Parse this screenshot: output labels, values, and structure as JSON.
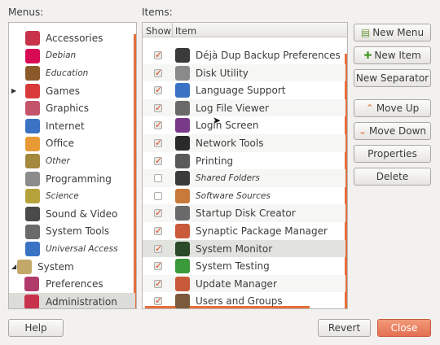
{
  "labels": {
    "menus": "Menus:",
    "items": "Items:"
  },
  "menus": [
    {
      "label": "Accessories",
      "icon": "accessories-icon",
      "italic": false,
      "color": "#c8324a",
      "kind": "top"
    },
    {
      "label": "Debian",
      "icon": "debian-icon",
      "italic": true,
      "color": "#d70a53",
      "kind": "top"
    },
    {
      "label": "Education",
      "icon": "education-icon",
      "italic": true,
      "color": "#8b5a2b",
      "kind": "top"
    },
    {
      "label": "Games",
      "icon": "games-icon",
      "italic": false,
      "color": "#d83a3a",
      "kind": "top",
      "expander": "▶"
    },
    {
      "label": "Graphics",
      "icon": "graphics-icon",
      "italic": false,
      "color": "#c4546a",
      "kind": "top"
    },
    {
      "label": "Internet",
      "icon": "internet-icon",
      "italic": false,
      "color": "#3a73c4",
      "kind": "top"
    },
    {
      "label": "Office",
      "icon": "office-icon",
      "italic": false,
      "color": "#e89a34",
      "kind": "top"
    },
    {
      "label": "Other",
      "icon": "other-icon",
      "italic": true,
      "color": "#a3883e",
      "kind": "top"
    },
    {
      "label": "Programming",
      "icon": "programming-icon",
      "italic": false,
      "color": "#8c8c8c",
      "kind": "top"
    },
    {
      "label": "Science",
      "icon": "science-icon",
      "italic": true,
      "color": "#b5a23a",
      "kind": "top"
    },
    {
      "label": "Sound & Video",
      "icon": "sound-video-icon",
      "italic": false,
      "color": "#4a4a4a",
      "kind": "top"
    },
    {
      "label": "System Tools",
      "icon": "system-tools-icon",
      "italic": false,
      "color": "#6a6a6a",
      "kind": "top"
    },
    {
      "label": "Universal Access",
      "icon": "universal-access-icon",
      "italic": true,
      "color": "#3a73c4",
      "kind": "top"
    },
    {
      "label": "System",
      "icon": "system-icon",
      "italic": false,
      "color": "#c4a86a",
      "kind": "system",
      "expander": "◢"
    },
    {
      "label": "Preferences",
      "icon": "preferences-icon",
      "italic": false,
      "color": "#b03a6a",
      "kind": "child"
    },
    {
      "label": "Administration",
      "icon": "administration-icon",
      "italic": false,
      "color": "#c8324a",
      "kind": "child",
      "selected": true
    }
  ],
  "items_header": {
    "show": "Show",
    "item": "Item"
  },
  "items": [
    {
      "label": "Déjà Dup Backup Preferences",
      "icon": "backup-icon",
      "checked": true,
      "italic": false,
      "color": "#3a3a3a"
    },
    {
      "label": "Disk Utility",
      "icon": "disk-utility-icon",
      "checked": true,
      "italic": false,
      "color": "#8a8a8a"
    },
    {
      "label": "Language Support",
      "icon": "language-support-icon",
      "checked": true,
      "italic": false,
      "color": "#3a73c4"
    },
    {
      "label": "Log File Viewer",
      "icon": "log-viewer-icon",
      "checked": true,
      "italic": false,
      "color": "#6a6a6a"
    },
    {
      "label": "Login Screen",
      "icon": "login-screen-icon",
      "checked": true,
      "italic": false,
      "color": "#7a3a8a"
    },
    {
      "label": "Network Tools",
      "icon": "network-tools-icon",
      "checked": true,
      "italic": false,
      "color": "#2a2a2a"
    },
    {
      "label": "Printing",
      "icon": "printer-icon",
      "checked": true,
      "italic": false,
      "color": "#5a5a5a"
    },
    {
      "label": "Shared Folders",
      "icon": "shared-folders-icon",
      "checked": false,
      "italic": true,
      "color": "#3a3a3a"
    },
    {
      "label": "Software Sources",
      "icon": "software-sources-icon",
      "checked": false,
      "italic": true,
      "color": "#c87a3a"
    },
    {
      "label": "Startup Disk Creator",
      "icon": "startup-disk-icon",
      "checked": true,
      "italic": false,
      "color": "#6a6a6a"
    },
    {
      "label": "Synaptic Package Manager",
      "icon": "synaptic-icon",
      "checked": true,
      "italic": false,
      "color": "#c85a3a"
    },
    {
      "label": "System Monitor",
      "icon": "system-monitor-icon",
      "checked": true,
      "italic": false,
      "color": "#2a4a2a",
      "selected": true
    },
    {
      "label": "System Testing",
      "icon": "system-testing-icon",
      "checked": true,
      "italic": false,
      "color": "#3a9a3a"
    },
    {
      "label": "Update Manager",
      "icon": "update-manager-icon",
      "checked": true,
      "italic": false,
      "color": "#c85a3a"
    },
    {
      "label": "Users and Groups",
      "icon": "users-groups-icon",
      "checked": true,
      "italic": false,
      "color": "#7a5a3a"
    }
  ],
  "buttons": {
    "new_menu": "New Menu",
    "new_item": "New Item",
    "new_separator": "New Separator",
    "move_up": "Move Up",
    "move_down": "Move Down",
    "properties": "Properties",
    "delete": "Delete",
    "help": "Help",
    "revert": "Revert",
    "close": "Close"
  },
  "colors": {
    "accent": "#e46f3c",
    "close_button": "#e46f52",
    "check": "#e04a1c"
  }
}
